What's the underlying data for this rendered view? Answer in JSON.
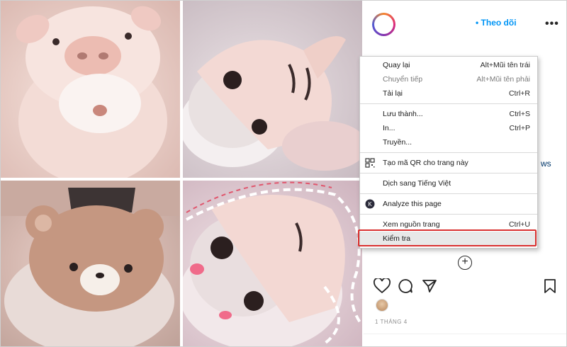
{
  "post": {
    "follow_label": "• Theo dõi",
    "more_icon": "more-horizontal-icon",
    "partial_text": "ws",
    "date": "1 THÁNG 4"
  },
  "actions": {
    "like_icon": "heart-icon",
    "comment_icon": "comment-icon",
    "share_icon": "send-icon",
    "save_icon": "bookmark-icon",
    "add_icon": "plus-circle-icon"
  },
  "context_menu": {
    "back": {
      "label": "Quay lại",
      "shortcut": "Alt+Mũi tên trái"
    },
    "forward": {
      "label": "Chuyển tiếp",
      "shortcut": "Alt+Mũi tên phải"
    },
    "reload": {
      "label": "Tải lại",
      "shortcut": "Ctrl+R"
    },
    "save_as": {
      "label": "Lưu thành...",
      "shortcut": "Ctrl+S"
    },
    "print": {
      "label": "In...",
      "shortcut": "Ctrl+P"
    },
    "cast": {
      "label": "Truyền..."
    },
    "qr": {
      "label": "Tạo mã QR cho trang này",
      "icon": "qr-code-icon"
    },
    "translate": {
      "label": "Dịch sang Tiếng Việt"
    },
    "analyze": {
      "label": "Analyze this page",
      "icon": "extension-k-icon"
    },
    "view_source": {
      "label": "Xem nguồn trang",
      "shortcut": "Ctrl+U"
    },
    "inspect": {
      "label": "Kiểm tra"
    }
  },
  "colors": {
    "accent_blue": "#0095f6",
    "highlight_box": "#d9302f"
  }
}
